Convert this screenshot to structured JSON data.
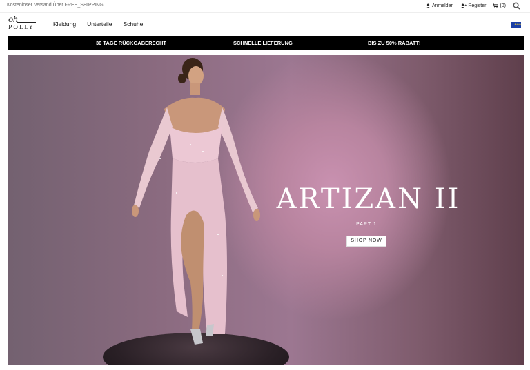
{
  "topbar": {
    "promo_text": "Kostenloser Versand Über FREE_SHIPPING",
    "login_label": "Anmelden",
    "register_label": "Register",
    "cart_count": "(0)"
  },
  "header": {
    "logo_script": "oh",
    "logo_word": "POLLY",
    "nav": [
      {
        "label": "Kleidung"
      },
      {
        "label": "Unterteile"
      },
      {
        "label": "Schuhe"
      }
    ]
  },
  "usp_bar": {
    "items": [
      {
        "label": "30 TAGE RÜCKGABERECHT"
      },
      {
        "label": "SCHNELLE LIEFERUNG"
      },
      {
        "label": "BIS ZU 50% RABATT!"
      }
    ]
  },
  "hero": {
    "headline": "ARTIZAN II",
    "subline": "PART 1",
    "cta_label": "SHOP NOW"
  },
  "colors": {
    "usp_background": "#000000",
    "hero_accent": "#c991b0",
    "flag_blue": "#1b3fa6"
  },
  "icons": [
    "user-icon",
    "user-plus-icon",
    "cart-icon",
    "search-icon",
    "eu-flag-icon"
  ]
}
